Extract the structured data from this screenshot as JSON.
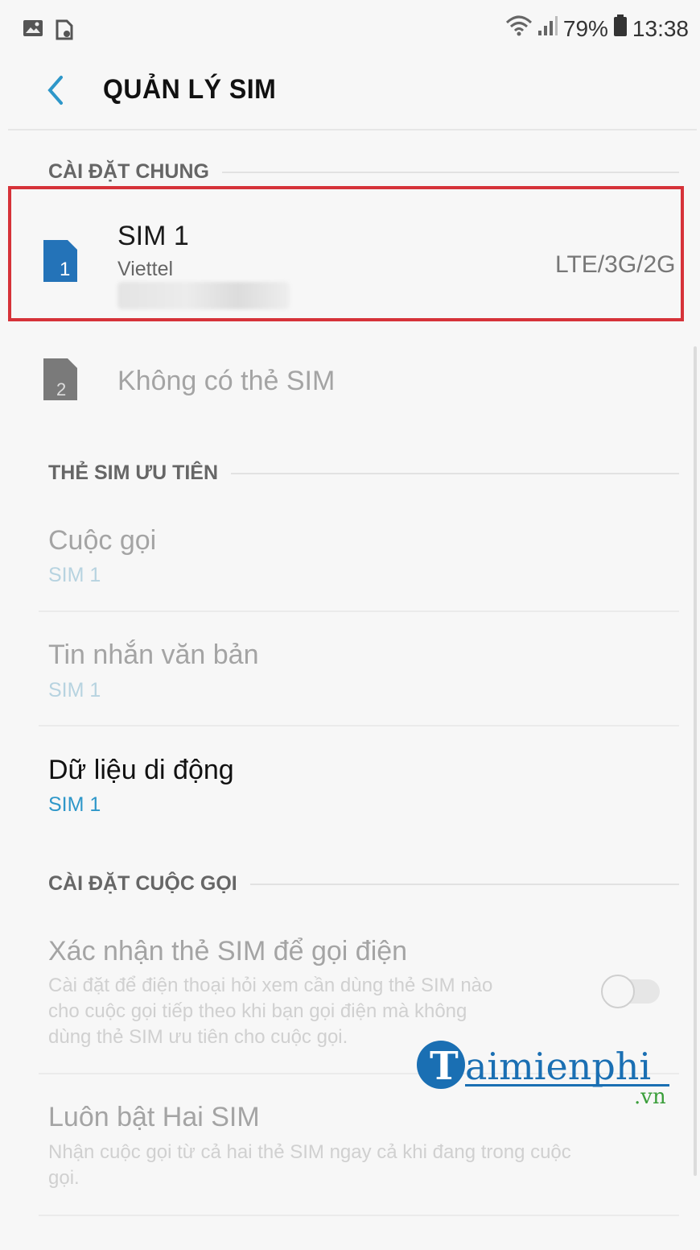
{
  "status_bar": {
    "battery": "79%",
    "time": "13:38"
  },
  "header": {
    "title": "QUẢN LÝ SIM"
  },
  "sections": {
    "general": "CÀI ĐẶT CHUNG",
    "preferred": "THẺ SIM ƯU TIÊN",
    "call_settings": "CÀI ĐẶT CUỘC GỌI"
  },
  "sim1": {
    "title": "SIM 1",
    "carrier": "Viettel",
    "network": "LTE/3G/2G",
    "icon_number": "1",
    "icon_color": "#2473b8"
  },
  "sim2": {
    "title": "Không có thẻ SIM",
    "icon_number": "2",
    "icon_color": "#7a7a7a"
  },
  "preferred_items": [
    {
      "title": "Cuộc gọi",
      "value": "SIM 1"
    },
    {
      "title": "Tin nhắn văn bản",
      "value": "SIM 1"
    },
    {
      "title": "Dữ liệu di động",
      "value": "SIM 1"
    }
  ],
  "call_items": [
    {
      "title": "Xác nhận thẻ SIM để gọi điện",
      "desc": [
        "Cài đặt để điện thoại hỏi xem cần dùng thẻ SIM nào",
        "cho cuộc gọi tiếp theo khi bạn gọi điện mà không",
        "dùng thẻ SIM ưu tiên cho cuộc gọi."
      ]
    },
    {
      "title": "Luôn bật Hai SIM",
      "desc": [
        "Nhận cuộc gọi từ cả hai thẻ SIM ngay cả khi đang trong cuộc",
        "gọi."
      ]
    }
  ],
  "watermark": {
    "brand": "aimienphi",
    "suffix": ".vn"
  },
  "colors": {
    "highlight": "#d63239",
    "accent": "#2e97c9",
    "logo_blue": "#1a6fb3",
    "logo_green": "#3a9e3a"
  }
}
